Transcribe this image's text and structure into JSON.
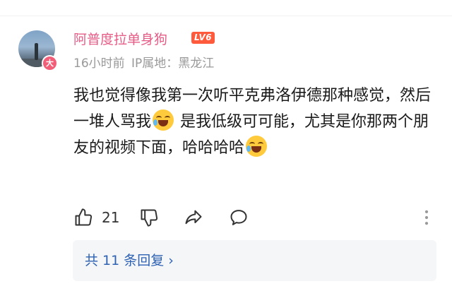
{
  "user": {
    "name": "阿普度拉单身狗",
    "level": "LV6",
    "vip_badge": "大",
    "time": "16小时前",
    "ip_location": "IP属地：黑龙江"
  },
  "comment": {
    "part1": "我也觉得像我第一次听平克弗洛伊德那种感觉，然后一堆人骂我",
    "part2": "是我低级可可能，尤其是你那两个朋友的视频下面，哈哈哈哈",
    "emoji_name": "laugh-cry-emoji"
  },
  "actions": {
    "like_count": "21"
  },
  "replies": {
    "label": "共 11 条回复 ›"
  },
  "colors": {
    "username": "#e55d87",
    "level_badge": "#ff5a3b",
    "link": "#2e62b3",
    "meta": "#999999"
  }
}
